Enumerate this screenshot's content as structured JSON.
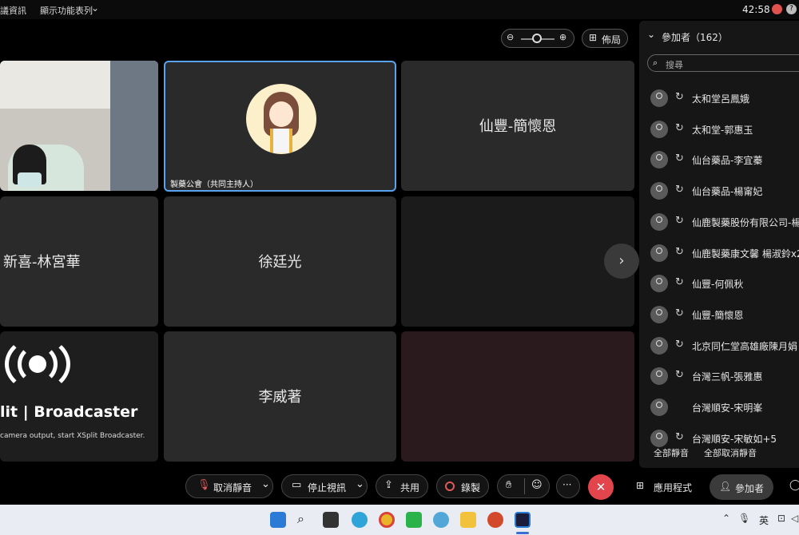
{
  "topbar": {
    "menu_info": "議資訊",
    "menu_view": "顯示功能表列",
    "clock": "42:58"
  },
  "toolbar": {
    "layout_label": "佈局"
  },
  "tiles": {
    "cohost_name": "製藥公會（共同主持人）",
    "t_xianfeng": "仙豐-簡懷恩",
    "t_xinxi": "新喜-林宮華",
    "t_xu": "徐廷光",
    "t_li": "李威著",
    "xsplit_title": "lit | Broadcaster",
    "xsplit_sub": "camera output, start XSplit Broadcaster."
  },
  "panel": {
    "title": "參加者（162）",
    "search_placeholder": "搜尋",
    "participants": [
      {
        "name": "太和堂呂鳳娥",
        "sync": true
      },
      {
        "name": "太和堂-郭惠玉",
        "sync": true
      },
      {
        "name": "仙台藥品-李宜蓁",
        "sync": true
      },
      {
        "name": "仙台藥品-楊甯妃",
        "sync": true
      },
      {
        "name": "仙鹿製藥股份有限公司-楊",
        "sync": true
      },
      {
        "name": "仙鹿製藥康文馨 楊淑鈴x2",
        "sync": true
      },
      {
        "name": "仙豐-何佩秋",
        "sync": true
      },
      {
        "name": "仙豐-簡懷恩",
        "sync": true
      },
      {
        "name": "北京同仁堂高雄廠陳月娟",
        "sync": true
      },
      {
        "name": "台灣三帆-張雅惠",
        "sync": true
      },
      {
        "name": "台灣順安-宋明峯",
        "sync": false
      },
      {
        "name": "台灣順安-宋敏如+5",
        "sync": true
      }
    ],
    "mute_all": "全部靜音",
    "unmute_all": "全部取消靜音"
  },
  "controls": {
    "unmute": "取消靜音",
    "stop_video": "停止視訊",
    "share": "共用",
    "record": "錄製",
    "more": "···",
    "apps": "應用程式",
    "participants": "參加者"
  },
  "taskbar": {
    "lang": "英"
  }
}
